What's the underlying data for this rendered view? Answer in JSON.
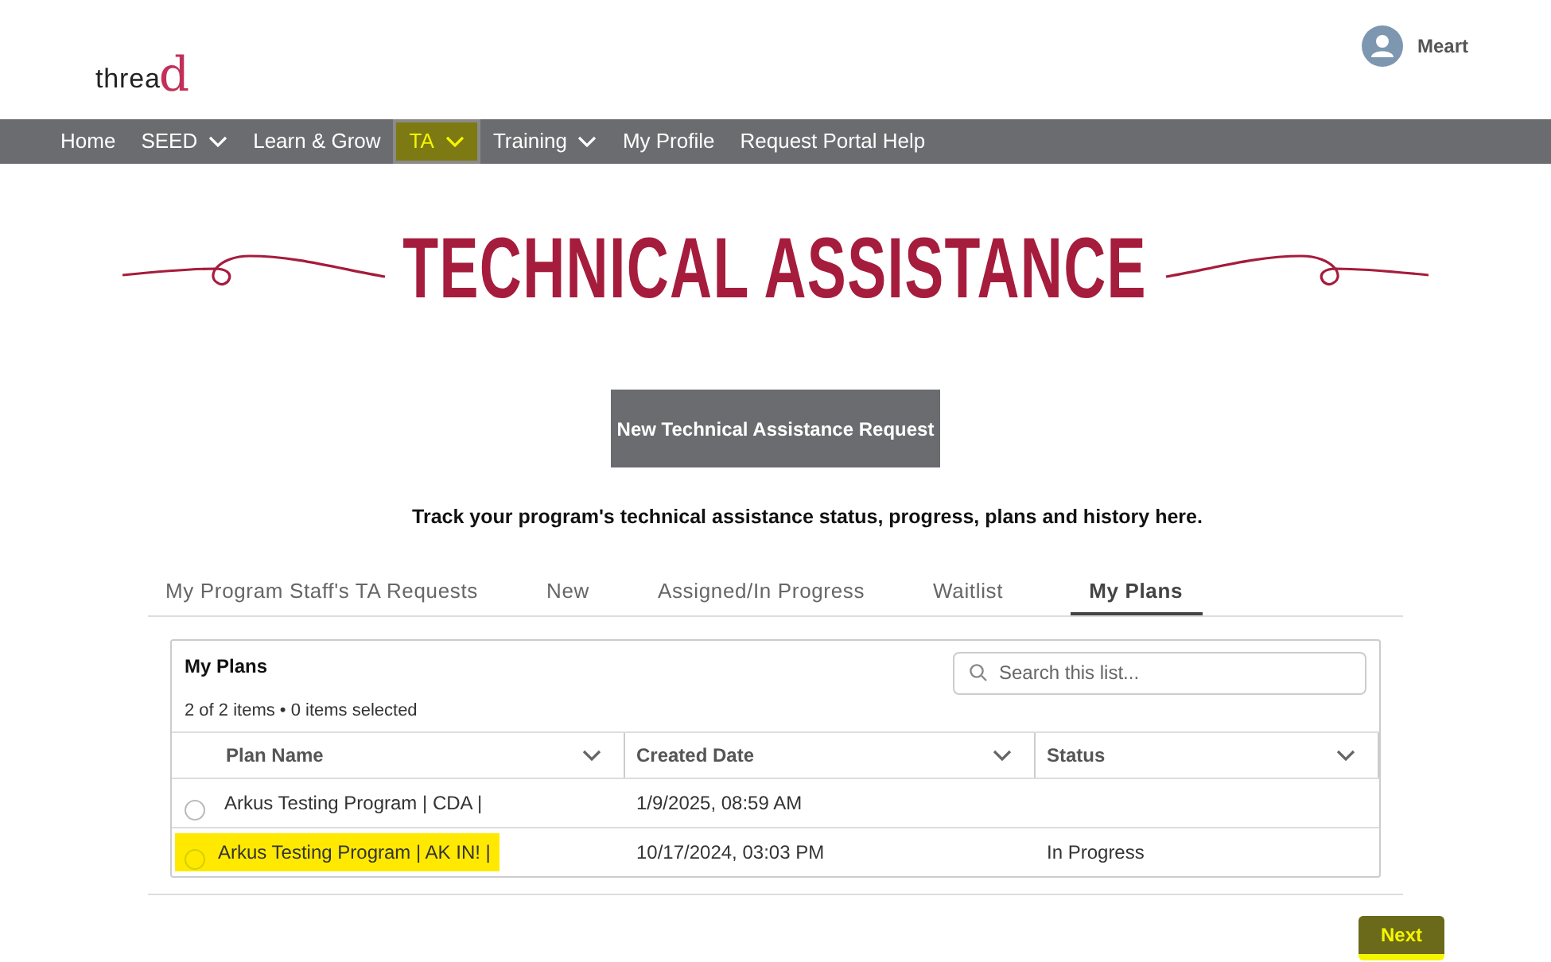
{
  "logo": {
    "text": "threa",
    "accent": "d"
  },
  "user": {
    "name": "Meart"
  },
  "nav": [
    {
      "label": "Home",
      "dropdown": false,
      "selected": false
    },
    {
      "label": "SEED",
      "dropdown": true,
      "selected": false
    },
    {
      "label": "Learn & Grow",
      "dropdown": false,
      "selected": false
    },
    {
      "label": "TA",
      "dropdown": true,
      "selected": true
    },
    {
      "label": "Training",
      "dropdown": true,
      "selected": false
    },
    {
      "label": "My Profile",
      "dropdown": false,
      "selected": false
    },
    {
      "label": "Request Portal Help",
      "dropdown": false,
      "selected": false
    }
  ],
  "banner": {
    "title": "TECHNICAL ASSISTANCE"
  },
  "new_request_button": "New Technical Assistance Request",
  "intro": "Track your program's technical assistance status, progress, plans and history here.",
  "tabs": [
    {
      "label": "My Program Staff's TA Requests",
      "selected": false
    },
    {
      "label": "New",
      "selected": false
    },
    {
      "label": "Assigned/In Progress",
      "selected": false
    },
    {
      "label": "Waitlist",
      "selected": false
    },
    {
      "label": "My Plans",
      "selected": true
    }
  ],
  "list": {
    "title": "My Plans",
    "summary": "2 of 2 items • 0 items selected",
    "search": {
      "placeholder": "Search this list..."
    },
    "columns": [
      "Plan Name",
      "Created Date",
      "Status"
    ],
    "rows": [
      {
        "cells": [
          "Arkus Testing Program | CDA |",
          "1/9/2025, 08:59 AM",
          ""
        ],
        "selected": false,
        "highlighted": false
      },
      {
        "cells": [
          "Arkus Testing Program | AK IN! |",
          "10/17/2024, 03:03 PM",
          "In Progress"
        ],
        "selected": false,
        "highlighted": true
      }
    ]
  },
  "next_button": {
    "label": "Next",
    "highlighted": true
  }
}
